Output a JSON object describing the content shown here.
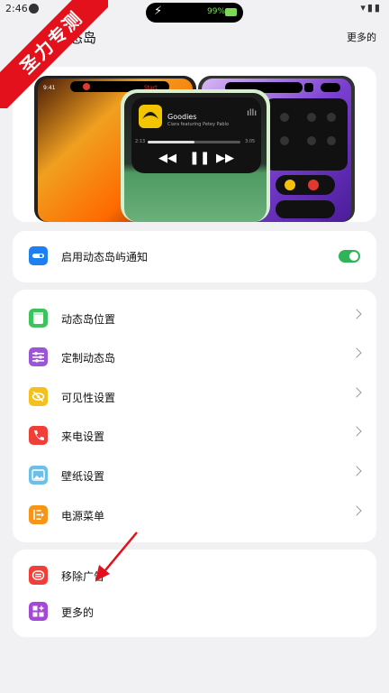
{
  "status": {
    "time": "2:46",
    "battery_percent": "99%"
  },
  "watermark": "圣力专测",
  "header": {
    "title": "动态岛",
    "more": "更多的"
  },
  "preview": {
    "track_title": "Goodies",
    "track_artist": "Ciara featuring Petey Pablo",
    "time_elapsed": "2:13",
    "time_total": "3:05"
  },
  "notify_toggle": {
    "label": "启用动态岛屿通知",
    "enabled": true
  },
  "settings": {
    "items": [
      {
        "label": "动态岛位置",
        "icon": "notepad-icon",
        "color": "#3cc35b"
      },
      {
        "label": "定制动态岛",
        "icon": "sliders-icon",
        "color": "#9b55d8"
      },
      {
        "label": "可见性设置",
        "icon": "eye-off-icon",
        "color": "#f3c01c"
      },
      {
        "label": "来电设置",
        "icon": "phone-icon",
        "color": "#f03f38"
      },
      {
        "label": "壁纸设置",
        "icon": "image-icon",
        "color": "#6cbfe8"
      },
      {
        "label": "电源菜单",
        "icon": "power-menu-icon",
        "color": "#f79516"
      }
    ]
  },
  "extra": {
    "remove_ads": {
      "label": "移除广告",
      "icon": "no-ads-icon",
      "color": "#f03f38"
    },
    "more": {
      "label": "更多的",
      "icon": "apps-grid-icon",
      "color": "#a548d6"
    }
  },
  "colors": {
    "toggle_on": "#2fb459",
    "toggle_icon": "#1e7ff0",
    "watermark": "#e3111c"
  }
}
